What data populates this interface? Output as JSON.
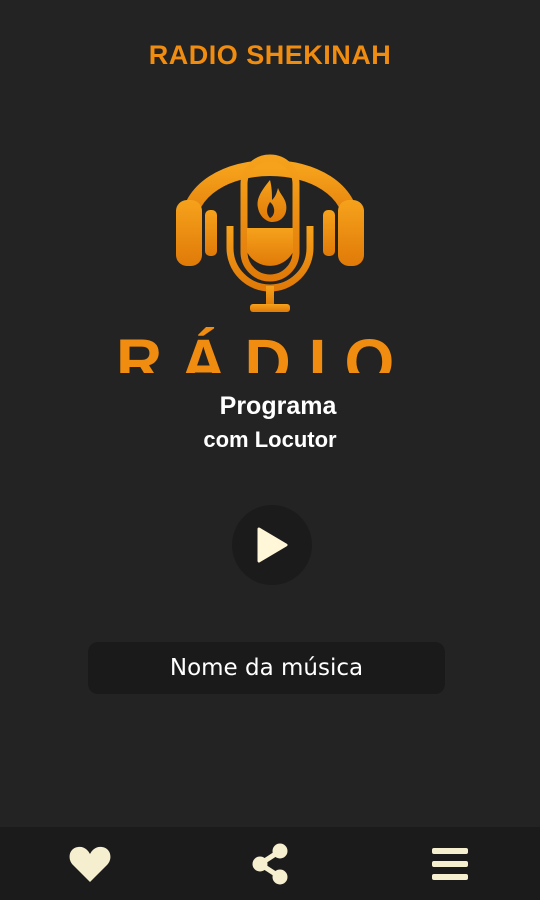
{
  "header": {
    "title": "RADIO SHEKINAH"
  },
  "logo": {
    "text": "RÁDIO",
    "icon": "headphones-microphone-flame-logo"
  },
  "program": {
    "line1": "Programa",
    "line2": "com Locutor"
  },
  "player": {
    "play_icon": "play-icon"
  },
  "song": {
    "title": "Nome da música"
  },
  "nav": {
    "items": [
      {
        "icon": "heart-icon"
      },
      {
        "icon": "share-icon"
      },
      {
        "icon": "menu-icon"
      }
    ]
  },
  "colors": {
    "accent": "#f08c10",
    "background": "#232323",
    "panel": "#1a1a1a",
    "icon": "#f5efcf"
  }
}
